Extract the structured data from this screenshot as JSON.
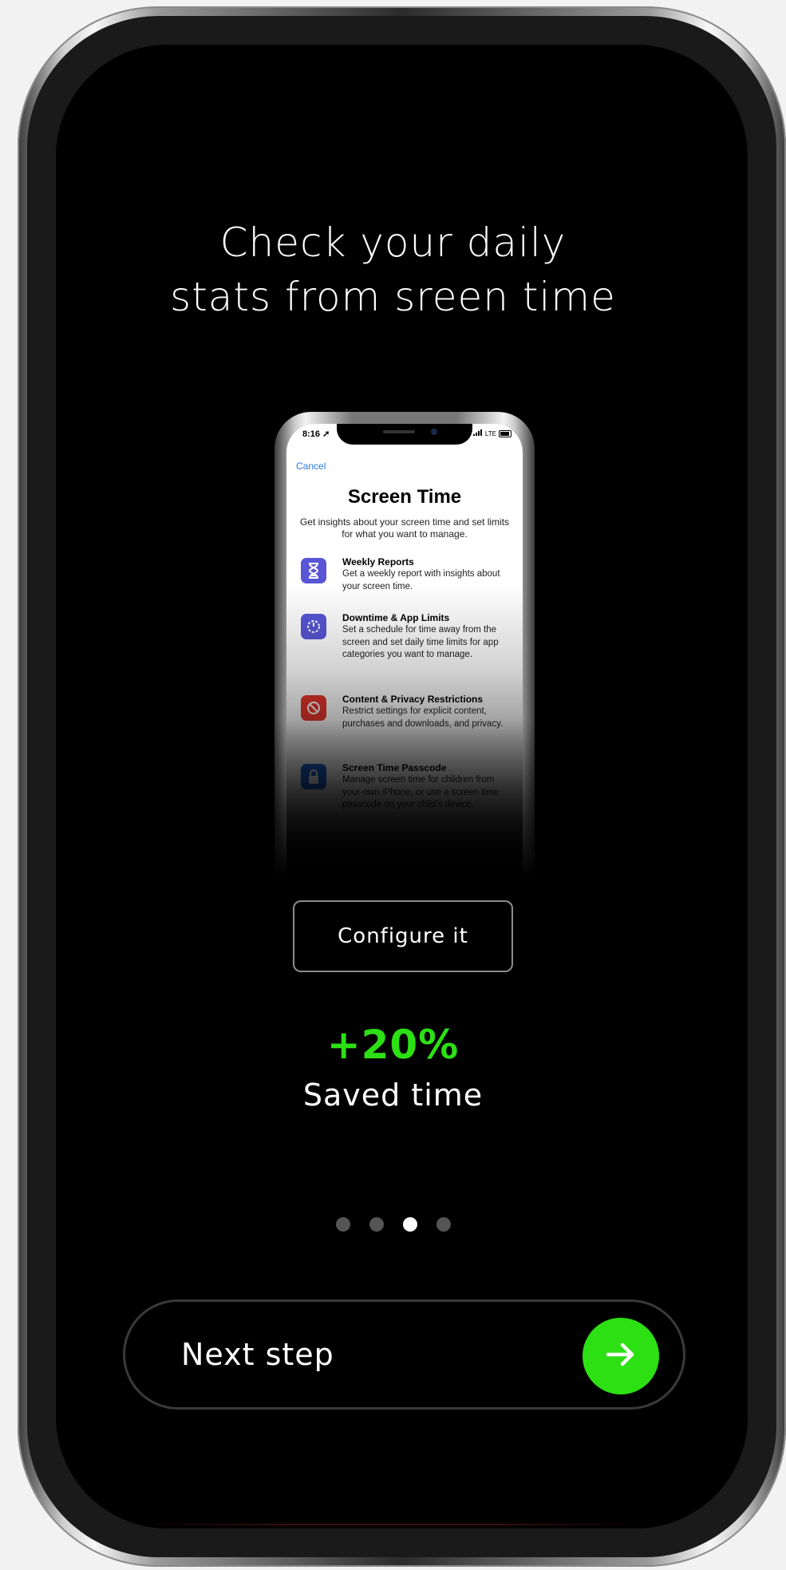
{
  "headline": {
    "line1": "Check your daily",
    "line2": "stats from sreen time"
  },
  "preview": {
    "status_time": "8:16",
    "status_network": "LTE",
    "cancel_label": "Cancel",
    "title": "Screen Time",
    "subtitle": "Get insights about your screen time and set limits for what you want to manage.",
    "items": [
      {
        "title": "Weekly Reports",
        "description": "Get a weekly report with insights about your screen time.",
        "icon": "hourglass-icon",
        "color": "#5856d6"
      },
      {
        "title": "Downtime & App Limits",
        "description": "Set a schedule for time away from the screen and set daily time limits for app categories you want to manage.",
        "icon": "timer-icon",
        "color": "#5856d6"
      },
      {
        "title": "Content & Privacy Restrictions",
        "description": "Restrict settings for explicit content, purchases and downloads, and privacy.",
        "icon": "block-icon",
        "color": "#e8372c"
      },
      {
        "title": "Screen Time Passcode",
        "description": "Manage screen time for children from your own iPhone, or use a screen time passcode on your child's device.",
        "icon": "lock-icon",
        "color": "#1f63d6"
      }
    ]
  },
  "configure_button": {
    "label": "Configure it"
  },
  "stat": {
    "value": "+20%",
    "label": "Saved time",
    "color": "#2ce014"
  },
  "pagination": {
    "total": 4,
    "active_index": 2
  },
  "next_button": {
    "label": "Next step",
    "icon": "arrow-right-icon",
    "color": "#2ce014"
  }
}
